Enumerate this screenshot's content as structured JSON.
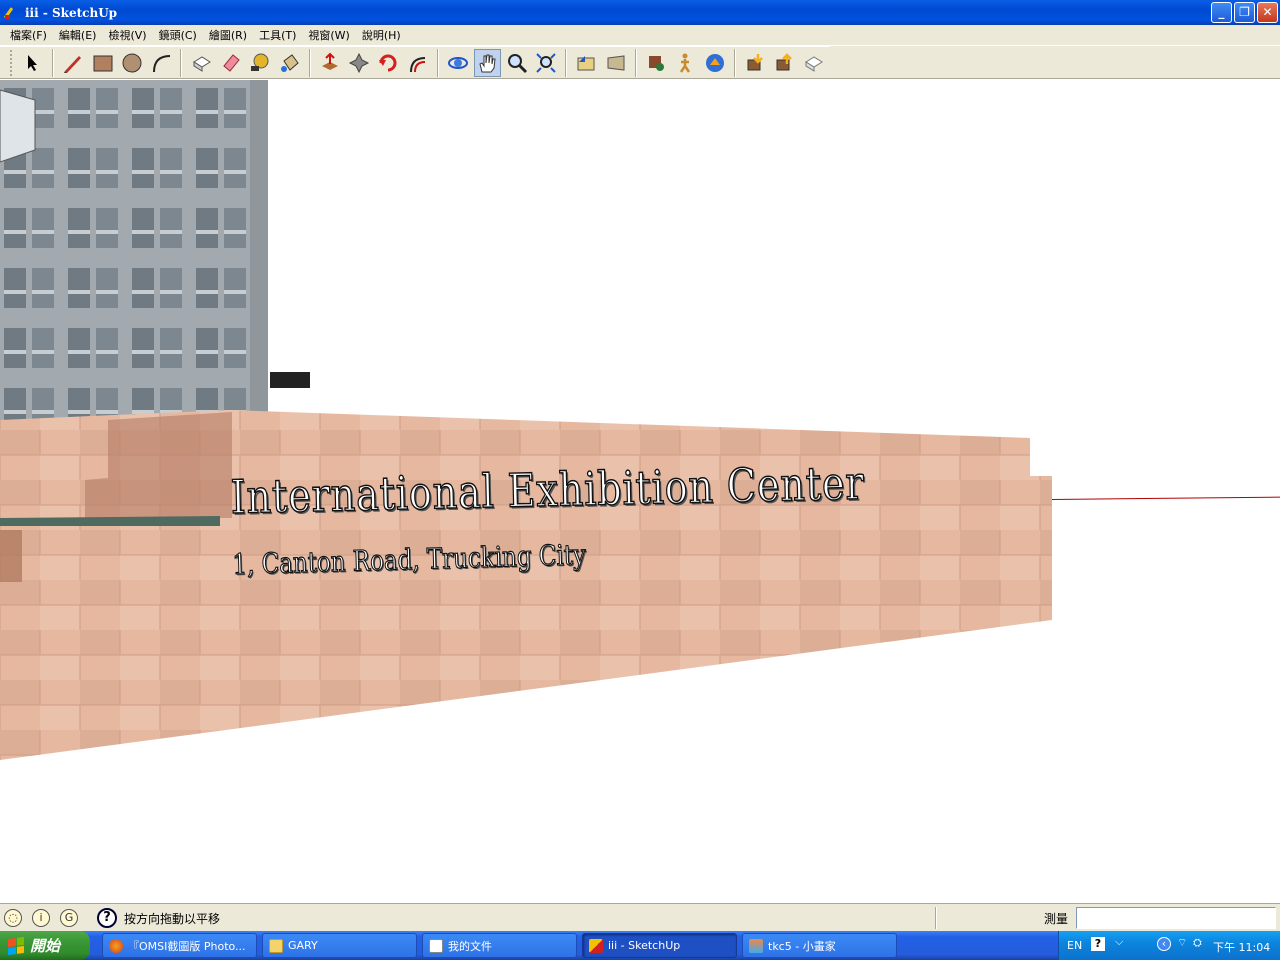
{
  "window": {
    "title": "iii - SketchUp",
    "controls": {
      "minimize_icon": "minimize-icon",
      "restore_icon": "restore-icon",
      "close_icon": "close-icon"
    }
  },
  "menu": [
    {
      "label": "檔案(F)"
    },
    {
      "label": "編輯(E)"
    },
    {
      "label": "檢視(V)"
    },
    {
      "label": "鏡頭(C)"
    },
    {
      "label": "繪圖(R)"
    },
    {
      "label": "工具(T)"
    },
    {
      "label": "視窗(W)"
    },
    {
      "label": "說明(H)"
    }
  ],
  "toolbar": {
    "tools": [
      {
        "name": "select-icon"
      },
      {
        "name": "pencil-icon"
      },
      {
        "name": "rectangle-icon"
      },
      {
        "name": "circle-icon"
      },
      {
        "name": "arc-icon"
      },
      {
        "name": "make-component-icon"
      },
      {
        "name": "eraser-icon"
      },
      {
        "name": "tape-measure-icon"
      },
      {
        "name": "paint-bucket-icon"
      },
      {
        "name": "push-pull-icon"
      },
      {
        "name": "move-icon"
      },
      {
        "name": "rotate-icon"
      },
      {
        "name": "offset-icon"
      },
      {
        "name": "orbit-icon"
      },
      {
        "name": "pan-icon",
        "active": true
      },
      {
        "name": "zoom-icon"
      },
      {
        "name": "zoom-extents-icon"
      },
      {
        "name": "previous-view-icon"
      },
      {
        "name": "next-view-icon"
      },
      {
        "name": "position-camera-icon"
      },
      {
        "name": "walk-icon"
      },
      {
        "name": "look-around-icon"
      },
      {
        "name": "get-models-icon"
      },
      {
        "name": "share-model-icon"
      },
      {
        "name": "share-component-icon"
      }
    ]
  },
  "viewport": {
    "sign_title": "International Exhibition Center",
    "sign_address": "1, Canton Road, Trucking City",
    "colors": {
      "wall": "#e6b8a0",
      "building": "#8f979d",
      "axis_red": "#b00000"
    }
  },
  "status": {
    "text": "按方向拖動以平移",
    "measure_label": "測量",
    "measure_value": ""
  },
  "taskbar": {
    "start": "開始",
    "tasks": [
      {
        "label": "『OMSI截圖版 Photo...",
        "icon": "firefox-icon"
      },
      {
        "label": "GARY",
        "icon": "folder-icon"
      },
      {
        "label": "我的文件",
        "icon": "document-icon"
      },
      {
        "label": "iii - SketchUp",
        "icon": "sketchup-icon",
        "active": true
      },
      {
        "label": "tkc5 - 小畫家",
        "icon": "paint-icon"
      }
    ],
    "tray": {
      "lang": "EN",
      "time": "下午 11:04"
    }
  }
}
